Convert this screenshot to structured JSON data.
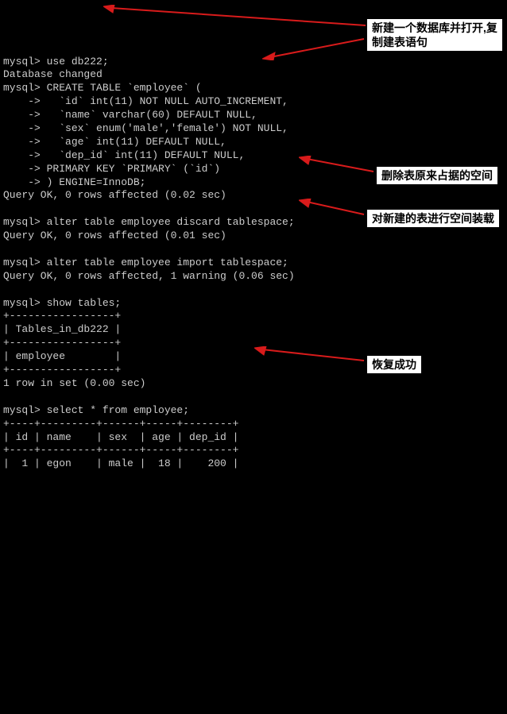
{
  "terminal": {
    "lines": [
      "mysql> use db222;",
      "Database changed",
      "mysql> CREATE TABLE `employee` (",
      "    ->   `id` int(11) NOT NULL AUTO_INCREMENT,",
      "    ->   `name` varchar(60) DEFAULT NULL,",
      "    ->   `sex` enum('male','female') NOT NULL,",
      "    ->   `age` int(11) DEFAULT NULL,",
      "    ->   `dep_id` int(11) DEFAULT NULL,",
      "    -> PRIMARY KEY `PRIMARY` (`id`)",
      "    -> ) ENGINE=InnoDB;",
      "Query OK, 0 rows affected (0.02 sec)",
      "",
      "mysql> alter table employee discard tablespace;",
      "Query OK, 0 rows affected (0.01 sec)",
      "",
      "mysql> alter table employee import tablespace;",
      "Query OK, 0 rows affected, 1 warning (0.06 sec)",
      "",
      "mysql> show tables;",
      "+-----------------+",
      "| Tables_in_db222 |",
      "+-----------------+",
      "| employee        |",
      "+-----------------+",
      "1 row in set (0.00 sec)",
      "",
      "mysql> select * from employee;",
      "+----+---------+------+-----+--------+",
      "| id | name    | sex  | age | dep_id |",
      "+----+---------+------+-----+--------+",
      "|  1 | egon    | male |  18 |    200 |"
    ]
  },
  "annotations": {
    "a1": "新建一个数据库并打开,复制建表语句",
    "a2": "删除表原来占据的空间",
    "a3": "对新建的表进行空间装载",
    "a4": "恢复成功"
  },
  "chart_data": {
    "type": "table",
    "tables": [
      {
        "title": "Tables_in_db222",
        "rows": [
          "employee"
        ]
      },
      {
        "title": "employee",
        "columns": [
          "id",
          "name",
          "sex",
          "age",
          "dep_id"
        ],
        "rows": [
          [
            1,
            "egon",
            "male",
            18,
            200
          ]
        ]
      }
    ]
  }
}
